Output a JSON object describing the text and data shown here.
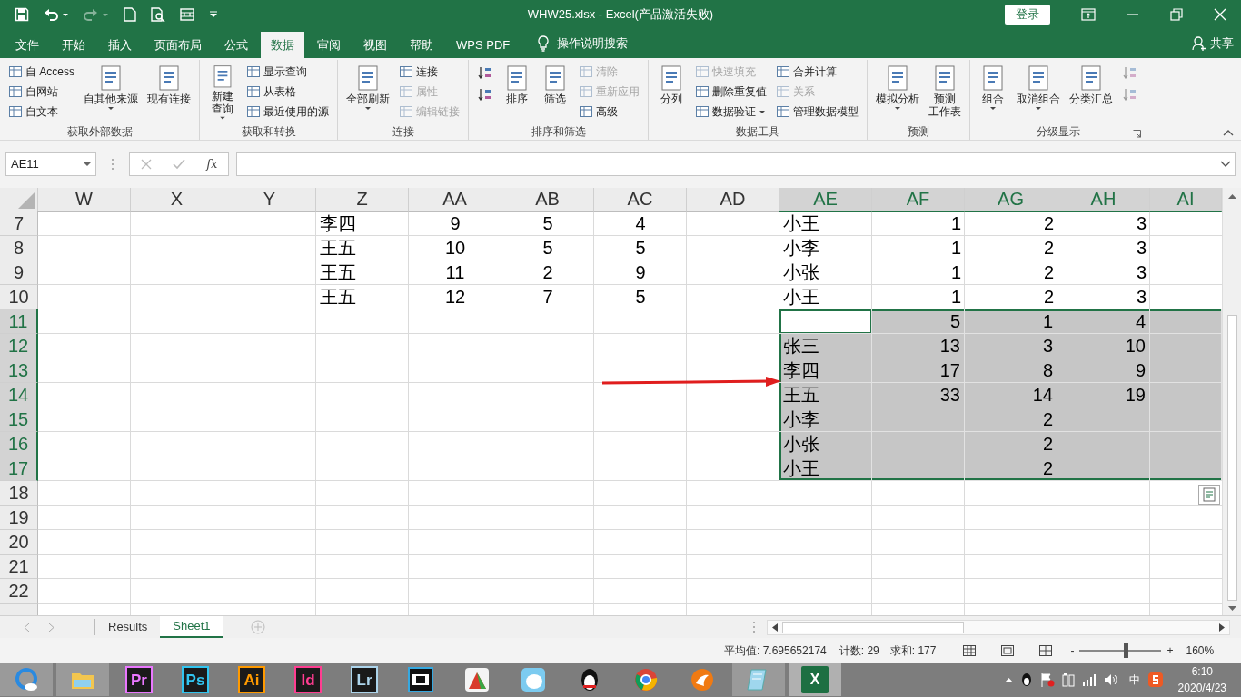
{
  "window": {
    "title": "WHW25.xlsx  -  Excel(产品激活失败)",
    "sign_in": "登录"
  },
  "ribbon_tabs": [
    {
      "label": "文件",
      "selected": false
    },
    {
      "label": "开始",
      "selected": false
    },
    {
      "label": "插入",
      "selected": false
    },
    {
      "label": "页面布局",
      "selected": false
    },
    {
      "label": "公式",
      "selected": false
    },
    {
      "label": "数据",
      "selected": true
    },
    {
      "label": "审阅",
      "selected": false
    },
    {
      "label": "视图",
      "selected": false
    },
    {
      "label": "帮助",
      "selected": false
    },
    {
      "label": "WPS PDF",
      "selected": false
    }
  ],
  "tell_me": "操作说明搜索",
  "share": "共享",
  "ribbon_groups": [
    {
      "label": "获取外部数据",
      "launcher": false,
      "columns": [
        {
          "kind": "small",
          "items": [
            {
              "label": "自 Access",
              "disabled": false,
              "dropdown": false
            },
            {
              "label": "自网站",
              "disabled": false,
              "dropdown": false
            },
            {
              "label": "自文本",
              "disabled": false,
              "dropdown": false
            }
          ]
        },
        {
          "kind": "large",
          "items": [
            {
              "lines": [
                "自其他来源"
              ],
              "disabled": false,
              "dropdown": true
            }
          ]
        },
        {
          "kind": "large",
          "items": [
            {
              "lines": [
                "现有连接"
              ],
              "disabled": false,
              "dropdown": false
            }
          ]
        }
      ]
    },
    {
      "label": "获取和转换",
      "launcher": false,
      "columns": [
        {
          "kind": "large",
          "items": [
            {
              "lines": [
                "新建",
                "查询"
              ],
              "disabled": false,
              "dropdown": true
            }
          ]
        },
        {
          "kind": "small",
          "items": [
            {
              "label": "显示查询",
              "disabled": false,
              "dropdown": false
            },
            {
              "label": "从表格",
              "disabled": false,
              "dropdown": false
            },
            {
              "label": "最近使用的源",
              "disabled": false,
              "dropdown": false
            }
          ]
        }
      ]
    },
    {
      "label": "连接",
      "launcher": false,
      "columns": [
        {
          "kind": "large",
          "items": [
            {
              "lines": [
                "全部刷新"
              ],
              "disabled": false,
              "dropdown": true
            }
          ]
        },
        {
          "kind": "small",
          "items": [
            {
              "label": "连接",
              "disabled": false,
              "dropdown": false
            },
            {
              "label": "属性",
              "disabled": true,
              "dropdown": false
            },
            {
              "label": "编辑链接",
              "disabled": true,
              "dropdown": false
            }
          ]
        }
      ]
    },
    {
      "label": "排序和筛选",
      "launcher": false,
      "columns": [
        {
          "kind": "small",
          "items": [
            {
              "disabled": false,
              "dropdown": false
            },
            {
              "disabled": false,
              "dropdown": false
            }
          ]
        },
        {
          "kind": "large",
          "items": [
            {
              "lines": [
                "排序"
              ],
              "disabled": false,
              "dropdown": false
            }
          ]
        },
        {
          "kind": "large",
          "items": [
            {
              "lines": [
                "筛选"
              ],
              "disabled": false,
              "dropdown": false
            }
          ]
        },
        {
          "kind": "small",
          "items": [
            {
              "label": "清除",
              "disabled": true,
              "dropdown": false
            },
            {
              "label": "重新应用",
              "disabled": true,
              "dropdown": false
            },
            {
              "label": "高级",
              "disabled": false,
              "dropdown": false
            }
          ]
        }
      ]
    },
    {
      "label": "数据工具",
      "launcher": false,
      "columns": [
        {
          "kind": "large",
          "items": [
            {
              "lines": [
                "分列"
              ],
              "disabled": false,
              "dropdown": false
            }
          ]
        },
        {
          "kind": "small",
          "items": [
            {
              "label": "快速填充",
              "disabled": true,
              "dropdown": false
            },
            {
              "label": "删除重复值",
              "disabled": false,
              "dropdown": false
            },
            {
              "label": "数据验证",
              "disabled": false,
              "dropdown": true
            }
          ]
        },
        {
          "kind": "small",
          "items": [
            {
              "label": "合并计算",
              "disabled": false,
              "dropdown": false
            },
            {
              "label": "关系",
              "disabled": true,
              "dropdown": false
            },
            {
              "label": "管理数据模型",
              "disabled": false,
              "dropdown": false
            }
          ]
        }
      ]
    },
    {
      "label": "预测",
      "launcher": false,
      "columns": [
        {
          "kind": "large",
          "items": [
            {
              "lines": [
                "模拟分析"
              ],
              "disabled": false,
              "dropdown": true
            }
          ]
        },
        {
          "kind": "large",
          "items": [
            {
              "lines": [
                "预测",
                "工作表"
              ],
              "disabled": false,
              "dropdown": false
            }
          ]
        }
      ]
    },
    {
      "label": "分级显示",
      "launcher": true,
      "columns": [
        {
          "kind": "large",
          "items": [
            {
              "lines": [
                "组合"
              ],
              "disabled": false,
              "dropdown": true
            }
          ]
        },
        {
          "kind": "large",
          "items": [
            {
              "lines": [
                "取消组合"
              ],
              "disabled": false,
              "dropdown": true
            }
          ]
        },
        {
          "kind": "large",
          "items": [
            {
              "lines": [
                "分类汇总"
              ],
              "disabled": false,
              "dropdown": false
            }
          ]
        },
        {
          "kind": "small",
          "items": [
            {
              "disabled": true,
              "dropdown": false
            },
            {
              "disabled": true,
              "dropdown": false
            }
          ]
        }
      ]
    }
  ],
  "formula_bar": {
    "name_box": "AE11",
    "function_label": "fx"
  },
  "sheet": {
    "columns": [
      {
        "label": "W",
        "kind": "text",
        "selected": false
      },
      {
        "label": "X",
        "kind": "text",
        "selected": false
      },
      {
        "label": "Y",
        "kind": "text",
        "selected": false
      },
      {
        "label": "Z",
        "kind": "text",
        "selected": false
      },
      {
        "label": "AA",
        "kind": "center",
        "selected": false
      },
      {
        "label": "AB",
        "kind": "center",
        "selected": false
      },
      {
        "label": "AC",
        "kind": "center",
        "selected": false
      },
      {
        "label": "AD",
        "kind": "text",
        "selected": false
      },
      {
        "label": "AE",
        "kind": "text",
        "selected": true
      },
      {
        "label": "AF",
        "kind": "number",
        "selected": true
      },
      {
        "label": "AG",
        "kind": "number",
        "selected": true
      },
      {
        "label": "AH",
        "kind": "number",
        "selected": true
      },
      {
        "label": "AI",
        "kind": "number",
        "selected": true
      }
    ],
    "rows": [
      {
        "header": "7",
        "selected": false,
        "active": false,
        "cells": [
          null,
          null,
          null,
          "李四",
          "9",
          "5",
          "4",
          null,
          "小王",
          "1",
          "2",
          "3",
          null
        ]
      },
      {
        "header": "8",
        "selected": false,
        "active": false,
        "cells": [
          null,
          null,
          null,
          "王五",
          "10",
          "5",
          "5",
          null,
          "小李",
          "1",
          "2",
          "3",
          null
        ]
      },
      {
        "header": "9",
        "selected": false,
        "active": false,
        "cells": [
          null,
          null,
          null,
          "王五",
          "11",
          "2",
          "9",
          null,
          "小张",
          "1",
          "2",
          "3",
          null
        ]
      },
      {
        "header": "10",
        "selected": false,
        "active": false,
        "cells": [
          null,
          null,
          null,
          "王五",
          "12",
          "7",
          "5",
          null,
          "小王",
          "1",
          "2",
          "3",
          null
        ]
      },
      {
        "header": "11",
        "selected": true,
        "active": true,
        "cells": [
          null,
          null,
          null,
          null,
          null,
          null,
          null,
          null,
          null,
          "5",
          "1",
          "4",
          null
        ]
      },
      {
        "header": "12",
        "selected": true,
        "active": false,
        "cells": [
          null,
          null,
          null,
          null,
          null,
          null,
          null,
          null,
          "张三",
          "13",
          "3",
          "10",
          null
        ]
      },
      {
        "header": "13",
        "selected": true,
        "active": false,
        "cells": [
          null,
          null,
          null,
          null,
          null,
          null,
          null,
          null,
          "李四",
          "17",
          "8",
          "9",
          null
        ]
      },
      {
        "header": "14",
        "selected": true,
        "active": false,
        "cells": [
          null,
          null,
          null,
          null,
          null,
          null,
          null,
          null,
          "王五",
          "33",
          "14",
          "19",
          null
        ]
      },
      {
        "header": "15",
        "selected": true,
        "active": false,
        "cells": [
          null,
          null,
          null,
          null,
          null,
          null,
          null,
          null,
          "小李",
          null,
          "2",
          null,
          null
        ]
      },
      {
        "header": "16",
        "selected": true,
        "active": false,
        "cells": [
          null,
          null,
          null,
          null,
          null,
          null,
          null,
          null,
          "小张",
          null,
          "2",
          null,
          null
        ]
      },
      {
        "header": "17",
        "selected": true,
        "active": false,
        "cells": [
          null,
          null,
          null,
          null,
          null,
          null,
          null,
          null,
          "小王",
          null,
          "2",
          null,
          null
        ]
      },
      {
        "header": "18",
        "selected": false,
        "active": false
      },
      {
        "header": "19",
        "selected": false,
        "active": false
      },
      {
        "header": "20",
        "selected": false,
        "active": false
      },
      {
        "header": "21",
        "selected": false,
        "active": false
      },
      {
        "header": "22",
        "selected": false,
        "active": false
      }
    ],
    "quick_analysis": true,
    "arrow_overlay": true
  },
  "sheet_tabs": [
    {
      "label": "Results",
      "selected": false
    },
    {
      "label": "Sheet1",
      "selected": true
    }
  ],
  "status_bar": {
    "average": "平均值: 7.695652174",
    "count": "计数: 29",
    "sum": "求和: 177",
    "zoom": {
      "minus": "-",
      "plus": "+",
      "level": 0.57,
      "reading": "160%"
    }
  },
  "taskbar": {
    "apps": [
      {
        "kind": "browser",
        "running": true,
        "active": false
      },
      {
        "kind": "folder",
        "running": true,
        "active": false
      },
      {
        "kind": "glyph",
        "text": "Pr",
        "color": "#ea77ff",
        "running": false,
        "active": false
      },
      {
        "kind": "glyph",
        "text": "Ps",
        "color": "#31c5f0",
        "running": false,
        "active": false
      },
      {
        "kind": "glyph",
        "text": "Ai",
        "color": "#ff9a00",
        "running": false,
        "active": false
      },
      {
        "kind": "glyph",
        "text": "Id",
        "color": "#ff3d91",
        "running": false,
        "active": false
      },
      {
        "kind": "glyph",
        "text": "Lr",
        "color": "#add5ec",
        "running": false,
        "active": false
      },
      {
        "kind": "film",
        "running": false,
        "active": false
      },
      {
        "kind": "chart",
        "running": false,
        "active": false
      },
      {
        "kind": "cartoon",
        "running": false,
        "active": false
      },
      {
        "kind": "penguin",
        "running": false,
        "active": false
      },
      {
        "kind": "chrome",
        "running": false,
        "active": false
      },
      {
        "kind": "fox",
        "running": false,
        "active": false
      },
      {
        "kind": "notepad",
        "running": true,
        "active": false
      },
      {
        "kind": "excel",
        "text": "X",
        "running": true,
        "active": true
      }
    ],
    "tray": {
      "ime": "中",
      "time": "6:10",
      "date": "2020/4/23"
    }
  }
}
